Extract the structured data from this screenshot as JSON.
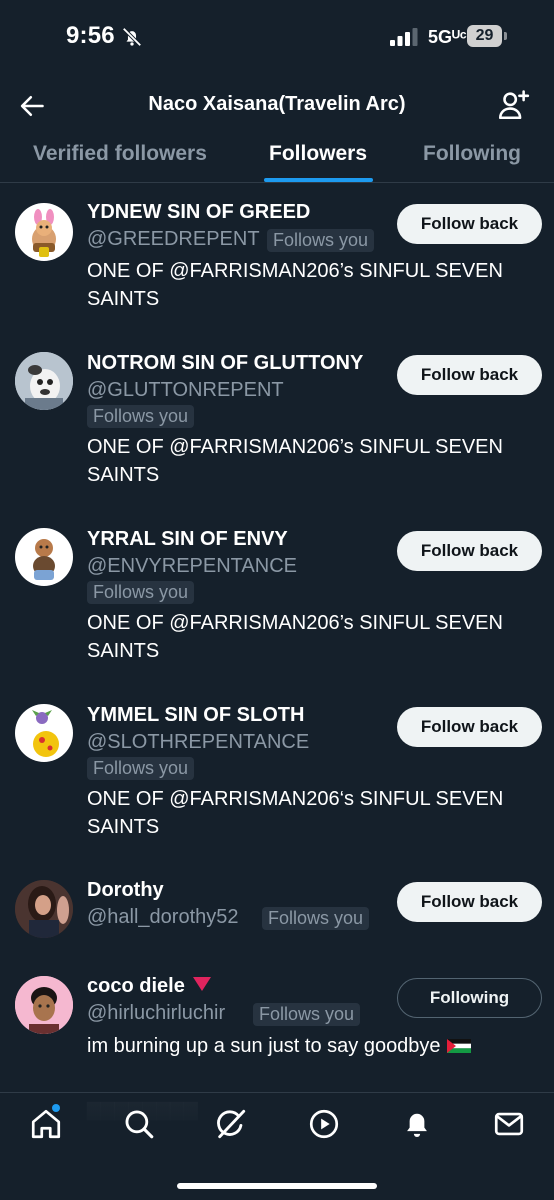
{
  "status_bar": {
    "time": "9:56",
    "network": "5Gᵁᶜ",
    "battery": "29",
    "mute_icon": "bell-slash-icon",
    "signal_icon": "signal-bars-icon"
  },
  "header": {
    "title": "Naco Xaisana(Travelin Arc)",
    "back_icon": "arrow-left-icon",
    "add_icon": "person-plus-icon"
  },
  "tabs": [
    {
      "label": "Verified followers",
      "active": false
    },
    {
      "label": "Followers",
      "active": true
    },
    {
      "label": "Following",
      "active": false
    }
  ],
  "accent_color": "#1d9bf0",
  "followers": [
    {
      "name": "YDNEW SIN OF GREED",
      "handle": "@GREEDREPENT",
      "follows_you": "Follows you",
      "bio": "ONE OF @FARRISMAN206’s SINFUL SEVEN SAINTS",
      "button": "Follow back"
    },
    {
      "name": "NOTROM SIN OF GLUTTONY",
      "handle": "@GLUTTONREPENT",
      "follows_you": "Follows you",
      "bio": "ONE OF @FARRISMAN206’s SINFUL SEVEN SAINTS",
      "button": "Follow back"
    },
    {
      "name": "YRRAL SIN OF ENVY",
      "handle": "@ENVYREPENTANCE",
      "follows_you": "Follows you",
      "bio": "ONE OF @FARRISMAN206’s SINFUL SEVEN SAINTS",
      "button": "Follow back"
    },
    {
      "name": "YMMEL SIN OF SLOTH",
      "handle": "@SLOTHREPENTANCE",
      "follows_you": "Follows you",
      "bio": "ONE OF @FARRISMAN206‘s SINFUL SEVEN SAINTS",
      "button": "Follow back"
    },
    {
      "name": "Dorothy",
      "handle": "@hall_dorothy52",
      "follows_you": "Follows you",
      "bio": "",
      "button": "Follow back"
    },
    {
      "name": "coco diele",
      "handle": "@hirluchirluchir",
      "follows_you": "Follows you",
      "bio": "im burning up a sun just to say goodbye",
      "button": "Following"
    }
  ],
  "bottom_nav": [
    {
      "icon": "home-icon",
      "active": true
    },
    {
      "icon": "search-icon",
      "active": false
    },
    {
      "icon": "grok-icon",
      "active": false
    },
    {
      "icon": "play-circle-icon",
      "active": false
    },
    {
      "icon": "bell-icon",
      "active": false
    },
    {
      "icon": "mail-icon",
      "active": false
    }
  ]
}
